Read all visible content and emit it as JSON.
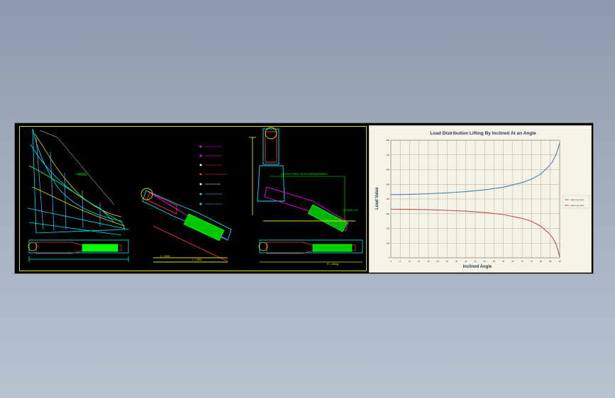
{
  "cad_notes": {
    "note_left": "CRANE",
    "note_middle_top": "LIFTING POINT / SLING ARRANGEMENT",
    "note_right": "LIFTING LUG",
    "dim_a": "L = 3000",
    "dim_b": "L = 2500",
    "dim_c": "R = 45deg"
  },
  "chart_data": {
    "type": "line",
    "title": "Load Distribution Lifting By Inclined At an Angle",
    "xlabel": "Inclined Angle",
    "ylabel": "Load Value",
    "xlim": [
      0,
      90
    ],
    "ylim": [
      0,
      800
    ],
    "grid": true,
    "legend_position": "right",
    "x": [
      0,
      10,
      20,
      30,
      40,
      50,
      60,
      70,
      75,
      80,
      84,
      86,
      88,
      89,
      90
    ],
    "series": [
      {
        "color": "#4a7fb0",
        "values": [
          430,
          432,
          436,
          442,
          450,
          462,
          480,
          512,
          535,
          570,
          620,
          650,
          700,
          740,
          780
        ]
      },
      {
        "color": "#c0504d",
        "values": [
          330,
          329,
          327,
          323,
          317,
          308,
          294,
          268,
          248,
          214,
          170,
          140,
          95,
          55,
          5
        ]
      }
    ],
    "legend_labels": [
      "Upper Lug Load",
      "Lower Lug Load"
    ],
    "x_ticks": [
      "0",
      "5",
      "10",
      "15",
      "20",
      "25",
      "30",
      "35",
      "40",
      "45",
      "50",
      "55",
      "60",
      "65",
      "70",
      "75",
      "80",
      "85",
      "90"
    ],
    "y_ticks": [
      "0",
      "100",
      "200",
      "300",
      "400",
      "500",
      "600",
      "700",
      "800"
    ]
  }
}
